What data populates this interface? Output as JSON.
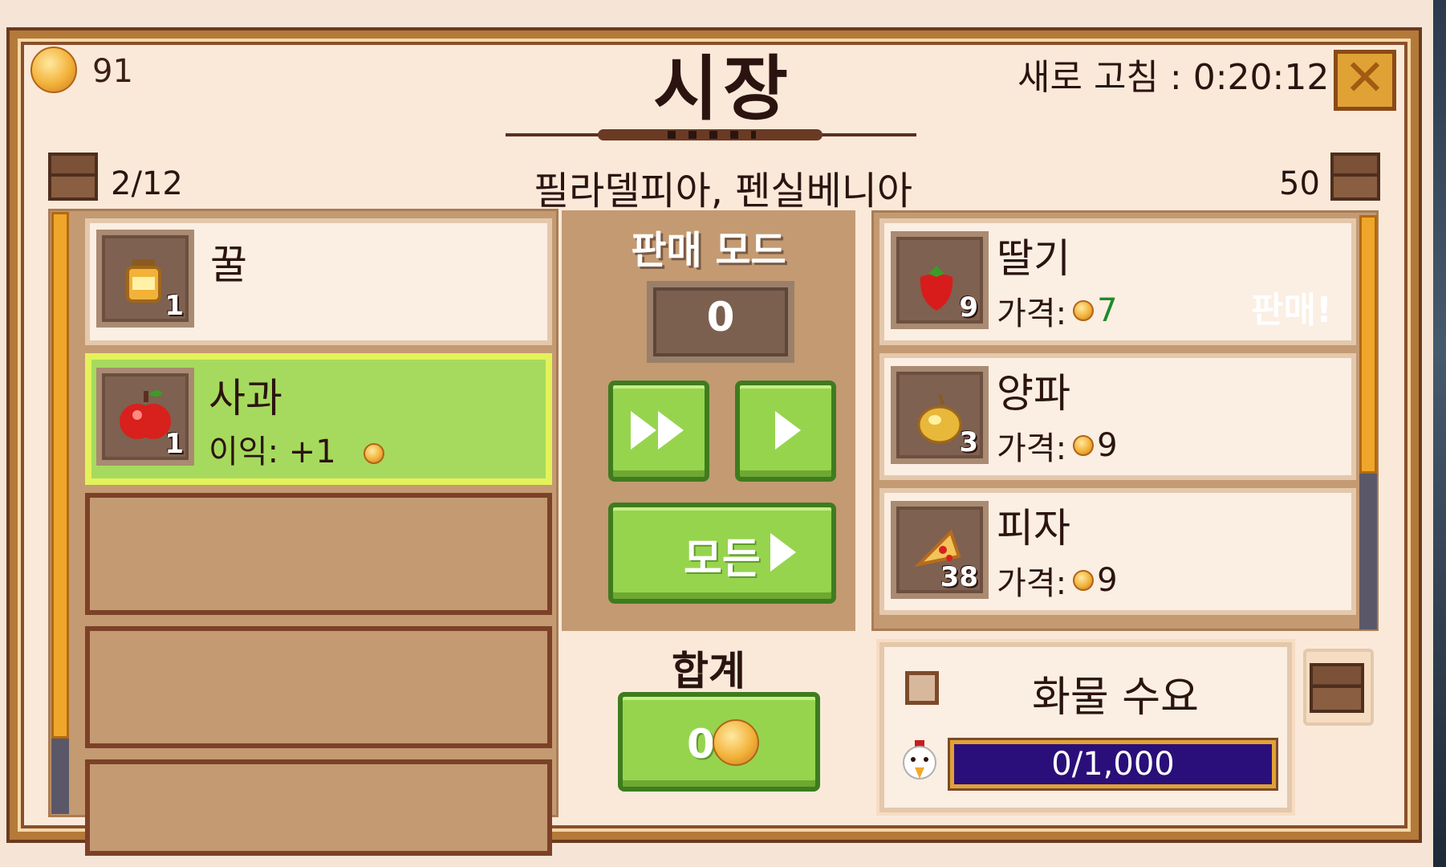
{
  "header": {
    "coins": "91",
    "title": "시장",
    "refresh_label": "새로 고침 : 0:20:12",
    "close_icon": "close-x-icon"
  },
  "location": {
    "capacity": "2/12",
    "name": "필라델피아, 펜실베니아",
    "chest_count": "50"
  },
  "inventory": [
    {
      "name": "꿀",
      "qty": "1",
      "icon": "honey-jar-icon",
      "selected": false
    },
    {
      "name": "사과",
      "qty": "1",
      "profit": "이익: +1",
      "icon": "apple-icon",
      "selected": true
    }
  ],
  "sell": {
    "mode_label": "판매 모드",
    "quantity": "0",
    "all_label": "모든",
    "total_label": "합계",
    "total_value": "0"
  },
  "shop": [
    {
      "name": "딸기",
      "qty": "9",
      "price_label": "가격:",
      "price": "7",
      "sell_tag": "판매!",
      "icon": "strawberry-icon",
      "price_color": "#1f8a2a"
    },
    {
      "name": "양파",
      "qty": "3",
      "price_label": "가격:",
      "price": "9",
      "icon": "onion-icon",
      "price_color": "#2b1410"
    },
    {
      "name": "피자",
      "qty": "38",
      "price_label": "가격:",
      "price": "9",
      "icon": "pizza-icon",
      "price_color": "#2b1410"
    }
  ],
  "cargo": {
    "title": "화물 수요",
    "progress_text": "0/1,000",
    "progress_fraction": 0
  }
}
